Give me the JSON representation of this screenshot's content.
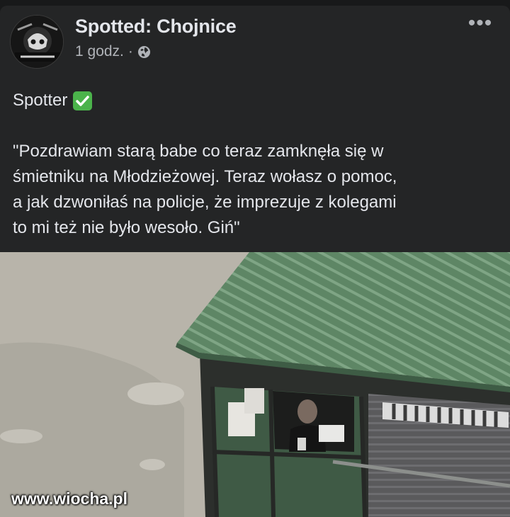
{
  "post": {
    "page_name": "Spotted: Chojnice",
    "timestamp": "1 godz.",
    "separator": "·",
    "privacy_icon": "globe-icon",
    "more_icon": "more-dots-icon",
    "more_label": "•••",
    "author_line": "Spotter",
    "author_badge_icon": "check-mark-icon",
    "text": "\"Pozdrawiam starą babe co teraz zamknęła się w\nśmietniku na Młodzieżowej. Teraz wołasz o pomoc,\na jak dzwoniłaś na policje, że imprezuje  z kolegami\nto mi też nie było wesoło. Giń\""
  },
  "photo": {
    "subject": "green-roof-waste-shelter",
    "watermark": "www.wiocha.pl"
  },
  "colors": {
    "background": "#18191a",
    "card": "#242526",
    "primary_text": "#e4e6eb",
    "secondary_text": "#b0b3b8",
    "check_badge": "#4bb34b",
    "roof": "#5d8463"
  }
}
